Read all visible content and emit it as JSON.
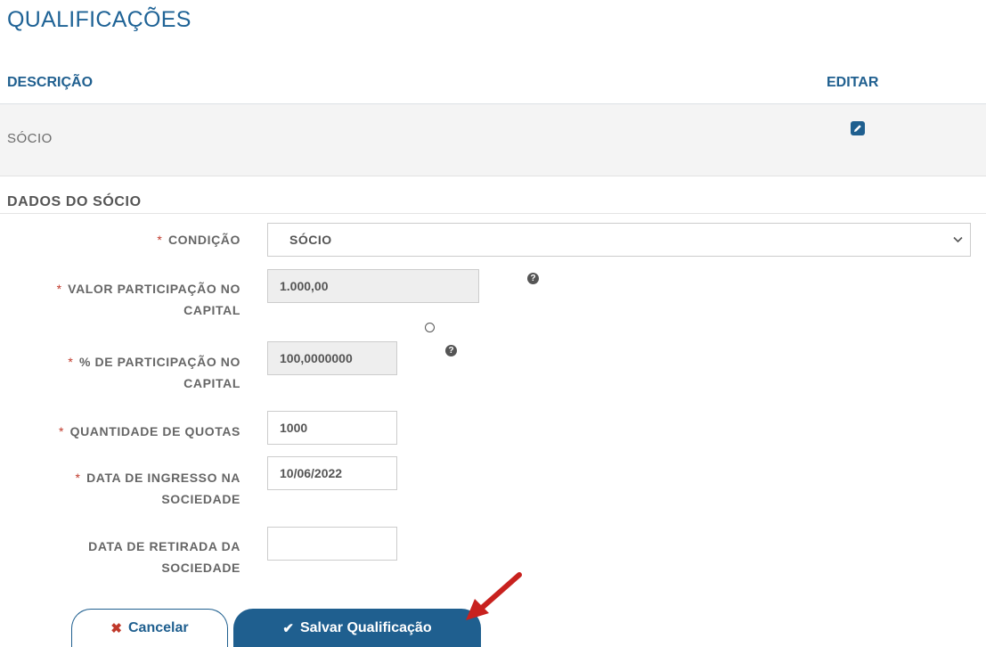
{
  "page": {
    "title": "QUALIFICAÇÕES"
  },
  "table": {
    "headers": {
      "description": "DESCRIÇÃO",
      "edit": "EDITAR"
    },
    "rows": [
      {
        "description": "SÓCIO"
      }
    ]
  },
  "section": {
    "title": "DADOS DO SÓCIO"
  },
  "form": {
    "required_mark": "*",
    "condicao": {
      "label": "CONDIÇÃO",
      "value": "SÓCIO"
    },
    "valor": {
      "label_line1": "VALOR PARTICIPAÇÃO NO",
      "label_line2": "CAPITAL",
      "value": "1.000,00"
    },
    "percentual": {
      "label_line1": "% DE PARTICIPAÇÃO NO",
      "label_line2": "CAPITAL",
      "value": "100,0000000"
    },
    "quotas": {
      "label": "QUANTIDADE DE QUOTAS",
      "value": "1000"
    },
    "ingresso": {
      "label_line1": "DATA DE INGRESSO NA",
      "label_line2": "SOCIEDADE",
      "value": "10/06/2022"
    },
    "retirada": {
      "label_line1": "DATA DE RETIRADA DA",
      "label_line2": "SOCIEDADE",
      "value": ""
    }
  },
  "icons": {
    "help": "question-circle-icon",
    "edit": "edit-icon",
    "cancel": "times-icon",
    "save": "check-icon"
  },
  "buttons": {
    "cancel": "Cancelar",
    "save": "Salvar Qualificação"
  },
  "colors": {
    "primary": "#1f5f8f",
    "title": "#1f6396",
    "required": "#c0392b",
    "arrow": "#c8211e"
  }
}
